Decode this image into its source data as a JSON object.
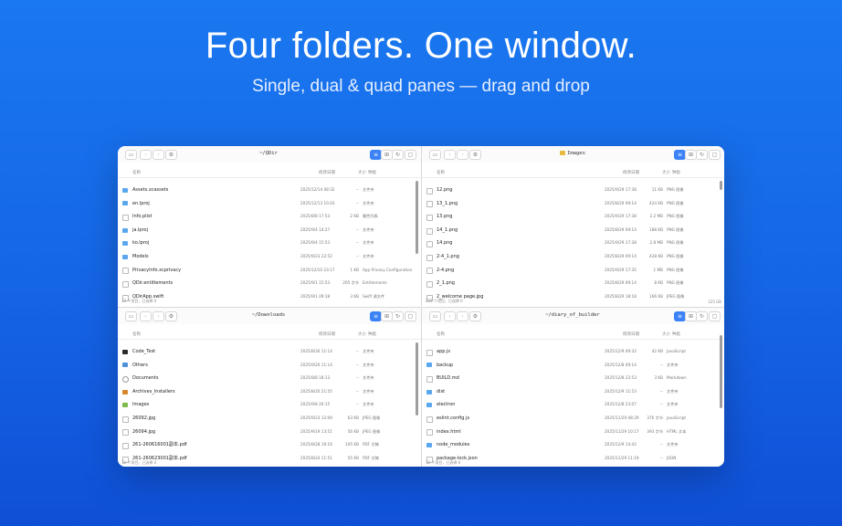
{
  "headline": "Four folders. One window.",
  "subline": "Single, dual & quad panes — drag and drop",
  "columns": {
    "name": "名称",
    "date": "修改日期",
    "size": "大小",
    "kind": "种类"
  },
  "icons": {
    "sidebar": "sidebar-icon",
    "back": "chevron-left-icon",
    "forward": "chevron-right-icon",
    "settings": "gear-icon",
    "list_view": "list-view-icon",
    "grid_view": "grid-view-icon",
    "refresh": "refresh-icon",
    "new_folder": "new-folder-icon"
  },
  "colors": {
    "accent": "#3b82f6",
    "folder": "#5aa7ef",
    "background": "#1a78f0"
  },
  "panes": [
    {
      "path": "~/QDir",
      "status": "12 个项目，已选择 0",
      "status_right": "",
      "rows": [
        {
          "name": "Assets.xcassets",
          "date": "2025/12/14 08:32",
          "size": "--",
          "kind": "文件夹",
          "icon": "folder"
        },
        {
          "name": "en.lproj",
          "date": "2025/12/13 10:43",
          "size": "--",
          "kind": "文件夹",
          "icon": "folder"
        },
        {
          "name": "Info.plist",
          "date": "2025/8/8 17:53",
          "size": "2 KB",
          "kind": "属性列表",
          "icon": "file"
        },
        {
          "name": "ja.lproj",
          "date": "2025/9/4 14:27",
          "size": "--",
          "kind": "文件夹",
          "icon": "folder"
        },
        {
          "name": "ko.lproj",
          "date": "2025/9/4 15:53",
          "size": "--",
          "kind": "文件夹",
          "icon": "folder"
        },
        {
          "name": "Models",
          "date": "2025/9/23 22:52",
          "size": "--",
          "kind": "文件夹",
          "icon": "folder"
        },
        {
          "name": "PrivacyInfo.xcprivacy",
          "date": "2025/12/10 23:17",
          "size": "1 KB",
          "kind": "App Privacy Configuration",
          "icon": "file"
        },
        {
          "name": "QDir.entitlements",
          "date": "2025/9/1 15:53",
          "size": "265 字节",
          "kind": "Entitlements",
          "icon": "file"
        },
        {
          "name": "QDirApp.swift",
          "date": "2025/9/1 09:18",
          "size": "3 KB",
          "kind": "Swift 源文件",
          "icon": "file"
        }
      ]
    },
    {
      "path": "Images",
      "status": "255 个项目，已选择 0",
      "status_right": "125 GB",
      "rows": [
        {
          "name": "12.png",
          "date": "2025/9/29 17:38",
          "size": "11 KB",
          "kind": "PNG 图像",
          "icon": "file"
        },
        {
          "name": "13_1.png",
          "date": "2025/8/29 09:14",
          "size": "424 KB",
          "kind": "PNG 图像",
          "icon": "file"
        },
        {
          "name": "13.png",
          "date": "2025/9/29 17:38",
          "size": "2.2 MB",
          "kind": "PNG 图像",
          "icon": "file"
        },
        {
          "name": "14_1.png",
          "date": "2025/8/29 09:14",
          "size": "188 KB",
          "kind": "PNG 图像",
          "icon": "file"
        },
        {
          "name": "14.png",
          "date": "2025/9/29 17:38",
          "size": "2.8 MB",
          "kind": "PNG 图像",
          "icon": "file"
        },
        {
          "name": "2-4_1.png",
          "date": "2025/8/29 09:14",
          "size": "428 KB",
          "kind": "PNG 图像",
          "icon": "file"
        },
        {
          "name": "2-4.png",
          "date": "2025/9/29 17:35",
          "size": "1 MB",
          "kind": "PNG 图像",
          "icon": "file"
        },
        {
          "name": "2_1.png",
          "date": "2025/8/29 09:14",
          "size": "8 KB",
          "kind": "PNG 图像",
          "icon": "file"
        },
        {
          "name": "2_welcome page.jpg",
          "date": "2025/8/29 18:18",
          "size": "166 KB",
          "kind": "JPEG 图像",
          "icon": "file"
        }
      ]
    },
    {
      "path": "~/Downloads",
      "status": "12 个项目，已选择 0",
      "status_right": "",
      "rows": [
        {
          "name": "Code_Test",
          "date": "2025/8/30 11:14",
          "size": "--",
          "kind": "文件夹",
          "icon": "folder-dark"
        },
        {
          "name": "Others",
          "date": "2025/9/20 11:14",
          "size": "--",
          "kind": "文件夹",
          "icon": "folder-grid"
        },
        {
          "name": "Documents",
          "date": "2025/8/8 18:13",
          "size": "--",
          "kind": "文件夹",
          "icon": "docs"
        },
        {
          "name": "Archives_Installers",
          "date": "2025/8/20 21:55",
          "size": "--",
          "kind": "文件夹",
          "icon": "folder-orange"
        },
        {
          "name": "Images",
          "date": "2025/9/8 20:15",
          "size": "--",
          "kind": "文件夹",
          "icon": "folder-green"
        },
        {
          "name": "26092.jpg",
          "date": "2025/9/23 12:09",
          "size": "63 KB",
          "kind": "JPEG 图像",
          "icon": "file"
        },
        {
          "name": "26094.jpg",
          "date": "2025/9/19 13:51",
          "size": "56 KB",
          "kind": "JPEG 图像",
          "icon": "file"
        },
        {
          "name": "261-260616001副本.pdf",
          "date": "2025/8/28 16:16",
          "size": "105 KB",
          "kind": "PDF 文稿",
          "icon": "file"
        },
        {
          "name": "261-260623001副本.pdf",
          "date": "2025/8/24 11:51",
          "size": "55 KB",
          "kind": "PDF 文稿",
          "icon": "file"
        }
      ]
    },
    {
      "path": "~/diary_of_builder",
      "status": "12 个项目，已选择 0",
      "status_right": "",
      "rows": [
        {
          "name": "app.js",
          "date": "2025/12/9 09:32",
          "size": "42 KB",
          "kind": "JavaScript",
          "icon": "file"
        },
        {
          "name": "backup",
          "date": "2025/12/8 09:14",
          "size": "--",
          "kind": "文件夹",
          "icon": "folder"
        },
        {
          "name": "BUILD.md",
          "date": "2025/12/8 22:53",
          "size": "3 KB",
          "kind": "Markdown",
          "icon": "file"
        },
        {
          "name": "dist",
          "date": "2025/12/9 11:53",
          "size": "--",
          "kind": "文件夹",
          "icon": "folder"
        },
        {
          "name": "electron",
          "date": "2025/12/8 23:07",
          "size": "--",
          "kind": "文件夹",
          "icon": "folder"
        },
        {
          "name": "eslint.config.js",
          "date": "2025/11/29 08:29",
          "size": "376 字节",
          "kind": "JavaScript",
          "icon": "file"
        },
        {
          "name": "index.html",
          "date": "2025/11/29 10:17",
          "size": "393 字节",
          "kind": "HTML 文本",
          "icon": "file"
        },
        {
          "name": "node_modules",
          "date": "2025/12/9 14:42",
          "size": "--",
          "kind": "文件夹",
          "icon": "folder"
        },
        {
          "name": "package-lock.json",
          "date": "2025/11/29 11:19",
          "size": "--",
          "kind": "JSON",
          "icon": "file"
        }
      ]
    }
  ]
}
